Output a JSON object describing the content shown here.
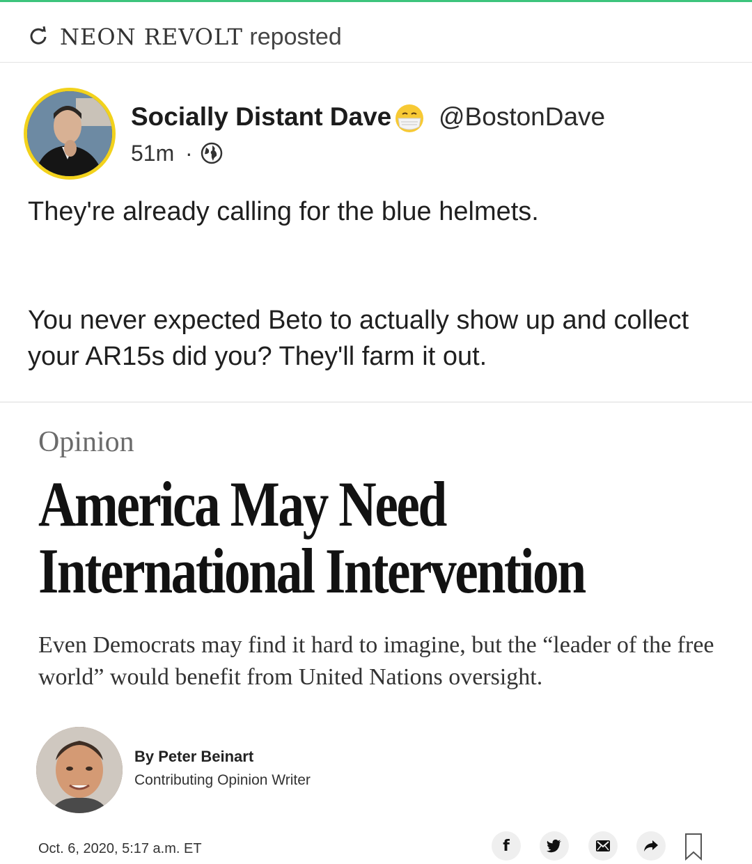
{
  "repost": {
    "account": "NEON REVOLT",
    "suffix": " reposted",
    "icon": "refresh-icon"
  },
  "post": {
    "author_name": "Socially Distant Dave",
    "author_emoji": "face-with-mask-icon",
    "handle": "@BostonDave",
    "time": "51m",
    "separator": "·",
    "visibility_icon": "globe-icon",
    "text_paragraph_1": "They're already calling for the blue helmets.",
    "text_paragraph_2": "You never expected Beto to actually show up and collect your AR15s did you? They'll farm it out."
  },
  "article": {
    "section": "Opinion",
    "headline": "America May Need International Intervention",
    "dek": "Even Democrats may find it hard to imagine, but the “leader of the free world” would benefit from United Nations oversight.",
    "byline": "By Peter Beinart",
    "writer_role": "Contributing Opinion Writer",
    "date": "Oct. 6, 2020, 5:17 a.m. ET",
    "share_buttons": [
      {
        "icon": "facebook-icon",
        "glyph": "f"
      },
      {
        "icon": "twitter-icon",
        "glyph": ""
      },
      {
        "icon": "email-icon",
        "glyph": ""
      },
      {
        "icon": "share-arrow-icon",
        "glyph": ""
      }
    ],
    "bookmark_icon": "bookmark-icon"
  },
  "colors": {
    "accent_top_line": "#3cc47c",
    "avatar_ring": "#f2d21c"
  }
}
